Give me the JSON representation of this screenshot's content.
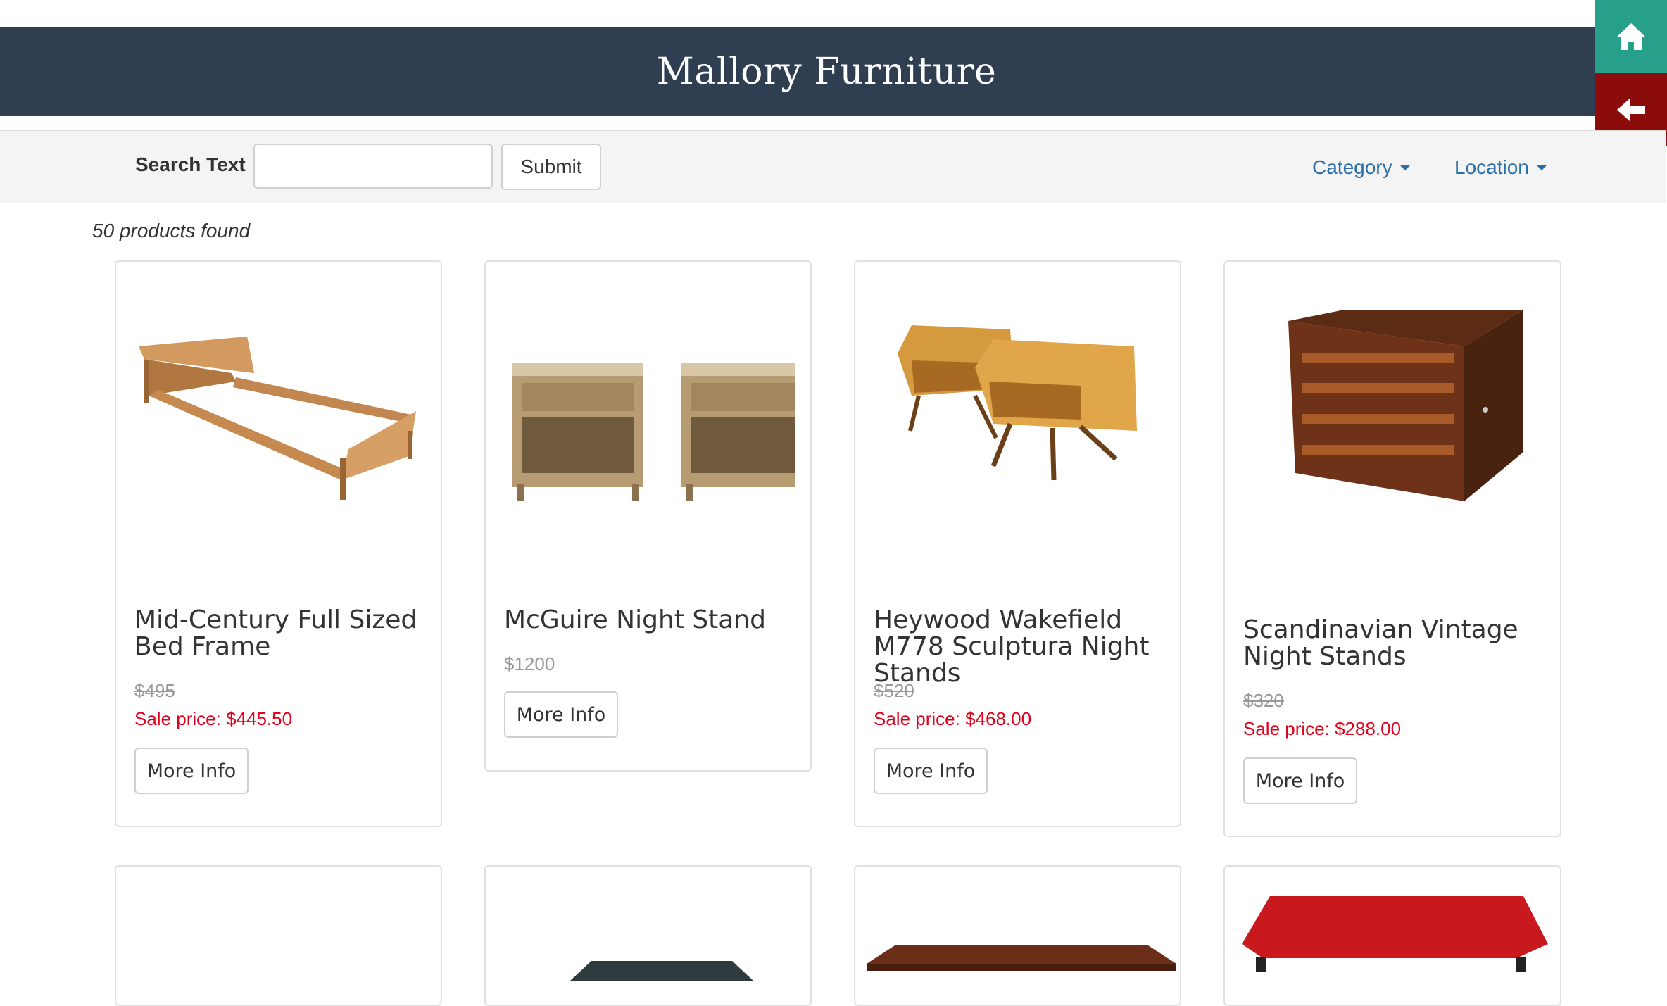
{
  "header": {
    "title": "Mallory Furniture"
  },
  "side_buttons": {
    "home_icon": "home-icon",
    "back_icon": "arrow-left-icon",
    "home_color": "#26a08a",
    "back_color": "#8c0b0b"
  },
  "search": {
    "label": "Search Text",
    "value": "",
    "placeholder": "",
    "submit_label": "Submit"
  },
  "filters": {
    "category_label": "Category",
    "location_label": "Location"
  },
  "results": {
    "count_text": "50 products found"
  },
  "products": [
    {
      "name": "Mid-Century Full Sized Bed Frame",
      "original_price": "$495",
      "sale_price": "Sale price: $445.50",
      "button": "More Info"
    },
    {
      "name": "McGuire Night Stand",
      "price": "$1200",
      "button": "More Info"
    },
    {
      "name": "Heywood Wakefield M778 Sculptura Night Stands",
      "original_price": "$520",
      "sale_price": "Sale price: $468.00",
      "button": "More Info"
    },
    {
      "name": "Scandinavian Vintage Night Stands",
      "original_price": "$320",
      "sale_price": "Sale price: $288.00",
      "button": "More Info"
    }
  ],
  "colors": {
    "header_bg": "#2f3e50",
    "link": "#2a6ea8",
    "sale": "#e2001a"
  }
}
